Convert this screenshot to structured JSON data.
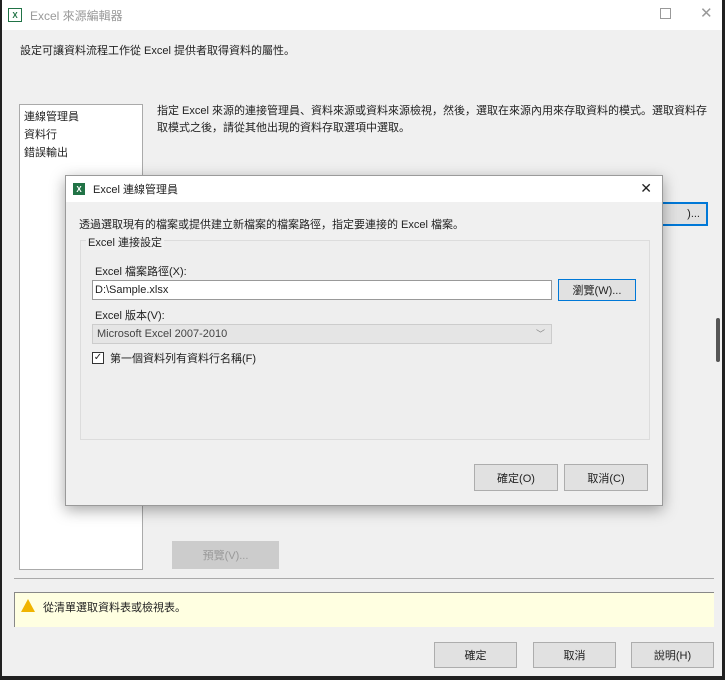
{
  "window": {
    "title": "Excel 來源編輯器",
    "maximize_icon": "maximize-icon",
    "close_icon": "close-icon",
    "description": "設定可讓資料流程工作從 Excel 提供者取得資料的屬性。",
    "nav": [
      "連線管理員",
      "資料行",
      "錯誤輸出"
    ],
    "instruction": "指定 Excel 來源的連接管理員、資料來源或資料來源檢視，然後，選取在來源內用來存取資料的模式。選取資料存取模式之後，請從其他出現的資料存取選項中選取。",
    "hidden_button": ")...",
    "preview_button": "預覽(V)...",
    "warning": "從清單選取資料表或檢視表。",
    "ok": "確定",
    "cancel": "取消",
    "help": "說明(H)"
  },
  "dialog": {
    "title": "Excel 連線管理員",
    "description": "透過選取現有的檔案或提供建立新檔案的檔案路徑，指定要連接的 Excel 檔案。",
    "group": "Excel 連接設定",
    "path_label": "Excel 檔案路徑(X):",
    "path_value": "D:\\Sample.xlsx",
    "browse": "瀏覽(W)...",
    "version_label": "Excel 版本(V):",
    "version_value": "Microsoft Excel 2007-2010",
    "checkbox_label": "第一個資料列有資料行名稱(F)",
    "checkbox_checked": true,
    "ok": "確定(O)",
    "cancel": "取消(C)"
  }
}
